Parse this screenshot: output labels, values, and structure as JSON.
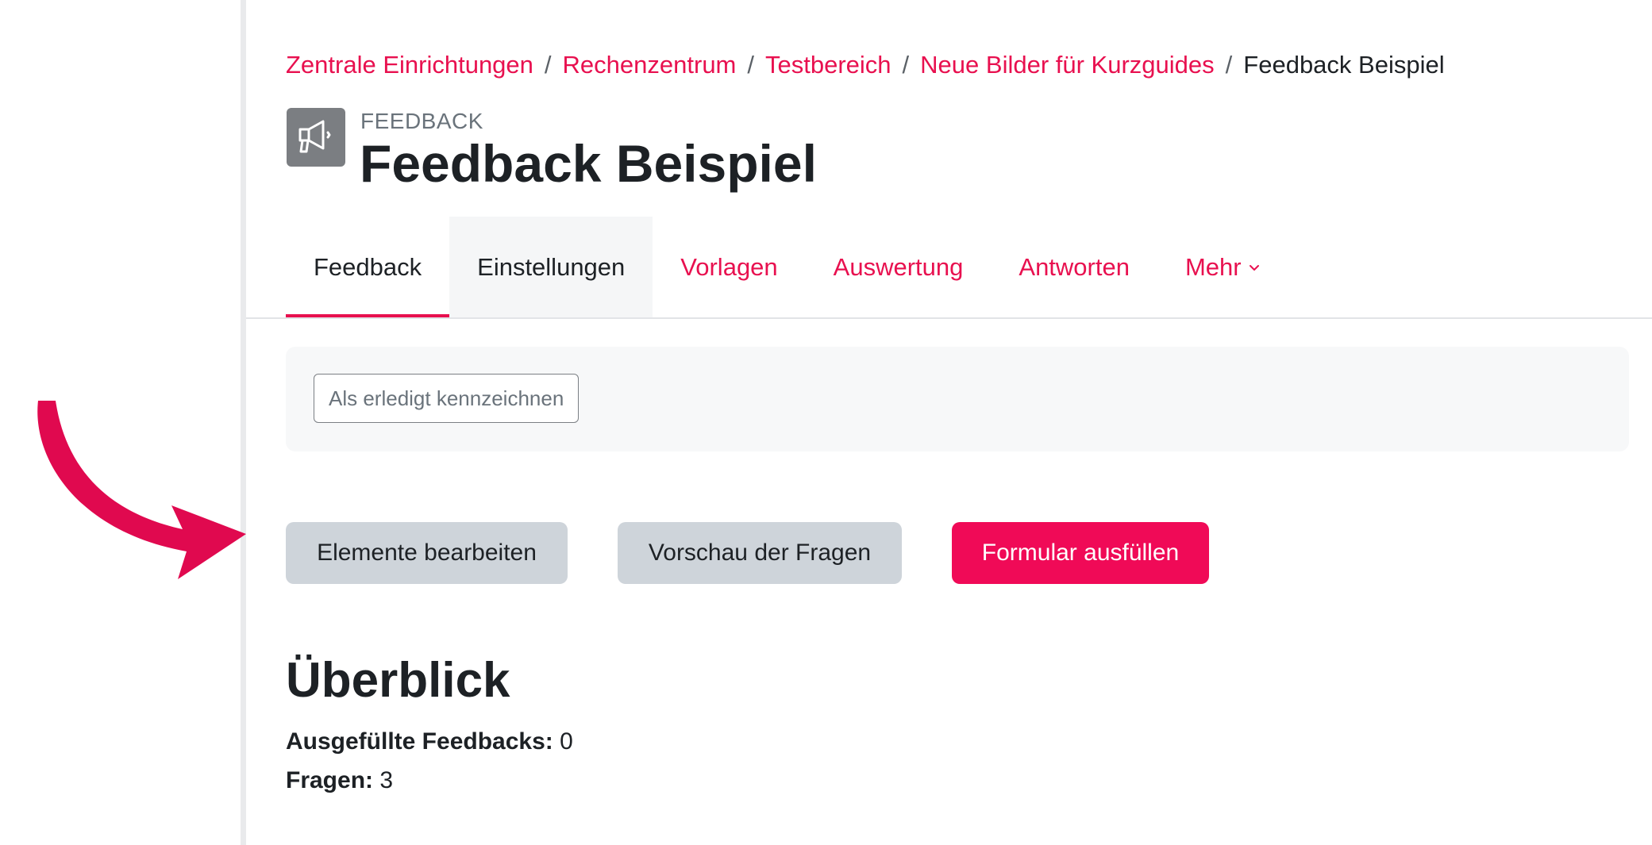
{
  "breadcrumb": {
    "items": [
      "Zentrale Einrichtungen",
      "Rechenzentrum",
      "Testbereich",
      "Neue Bilder für Kurzguides"
    ],
    "current": "Feedback Beispiel",
    "separator": "/"
  },
  "header": {
    "activity_type": "FEEDBACK",
    "title": "Feedback Beispiel",
    "icon": "megaphone-icon"
  },
  "tabs": [
    {
      "label": "Feedback",
      "state": "active"
    },
    {
      "label": "Einstellungen",
      "state": "hover"
    },
    {
      "label": "Vorlagen",
      "state": "link"
    },
    {
      "label": "Auswertung",
      "state": "link"
    },
    {
      "label": "Antworten",
      "state": "link"
    },
    {
      "label": "Mehr",
      "state": "dropdown"
    }
  ],
  "completion": {
    "mark_done_label": "Als erledigt kennzeichnen"
  },
  "actions": {
    "edit_items": "Elemente bearbeiten",
    "preview_questions": "Vorschau der Fragen",
    "fill_form": "Formular ausfüllen"
  },
  "overview": {
    "heading": "Überblick",
    "completed_label": "Ausgefüllte Feedbacks:",
    "completed_value": "0",
    "questions_label": "Fragen:",
    "questions_value": "3"
  },
  "colors": {
    "accent": "#f00a57",
    "link": "#e8104f",
    "annotation_arrow": "#e0094f"
  }
}
